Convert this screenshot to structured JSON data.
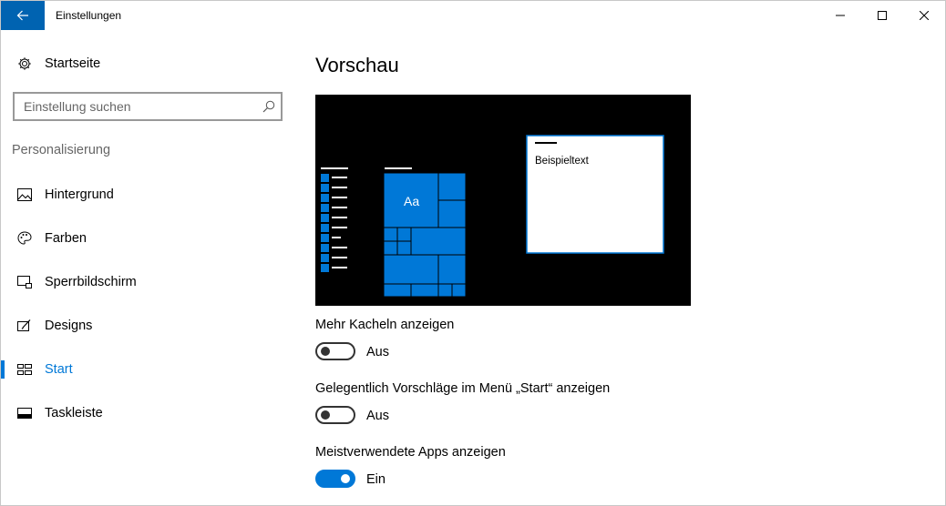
{
  "window": {
    "title": "Einstellungen",
    "accent": "#0078d7"
  },
  "sidebar": {
    "home": {
      "label": "Startseite",
      "icon": "gear-icon"
    },
    "search": {
      "placeholder": "Einstellung suchen",
      "icon": "search-icon"
    },
    "section": "Personalisierung",
    "items": [
      {
        "label": "Hintergrund",
        "icon": "picture-icon",
        "active": false
      },
      {
        "label": "Farben",
        "icon": "palette-icon",
        "active": false
      },
      {
        "label": "Sperrbildschirm",
        "icon": "lock-screen-icon",
        "active": false
      },
      {
        "label": "Designs",
        "icon": "brush-icon",
        "active": false
      },
      {
        "label": "Start",
        "icon": "start-icon",
        "active": true
      },
      {
        "label": "Taskleiste",
        "icon": "taskbar-icon",
        "active": false
      }
    ]
  },
  "main": {
    "title": "Vorschau",
    "preview": {
      "tile_label": "Aa",
      "sample_text": "Beispieltext"
    },
    "settings": [
      {
        "label": "Mehr Kacheln anzeigen",
        "state": "Aus",
        "on": false
      },
      {
        "label": "Gelegentlich Vorschläge im Menü „Start“ anzeigen",
        "state": "Aus",
        "on": false
      },
      {
        "label": "Meistverwendete Apps anzeigen",
        "state": "Ein",
        "on": true
      }
    ]
  }
}
